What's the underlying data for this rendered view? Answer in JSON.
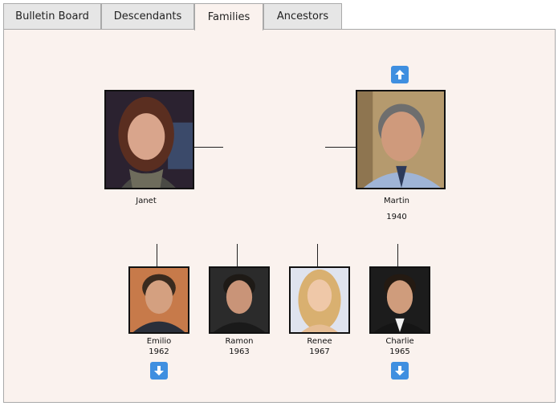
{
  "tabs": [
    {
      "label": "Bulletin Board"
    },
    {
      "label": "Descendants"
    },
    {
      "label": "Families"
    },
    {
      "label": "Ancestors"
    }
  ],
  "parents": {
    "mother": {
      "name": "Janet"
    },
    "father": {
      "name": "Martin",
      "year": "1940"
    }
  },
  "children": [
    {
      "name": "Emilio",
      "year": "1962"
    },
    {
      "name": "Ramon",
      "year": "1963"
    },
    {
      "name": "Renee",
      "year": "1967"
    },
    {
      "name": "Charlie",
      "year": "1965"
    }
  ],
  "icons": {
    "up": "arrow-up-icon",
    "down": "arrow-down-icon"
  },
  "colors": {
    "accent": "#3f8fe0",
    "panel": "#faf2ee",
    "tab": "#e6e6e6"
  }
}
